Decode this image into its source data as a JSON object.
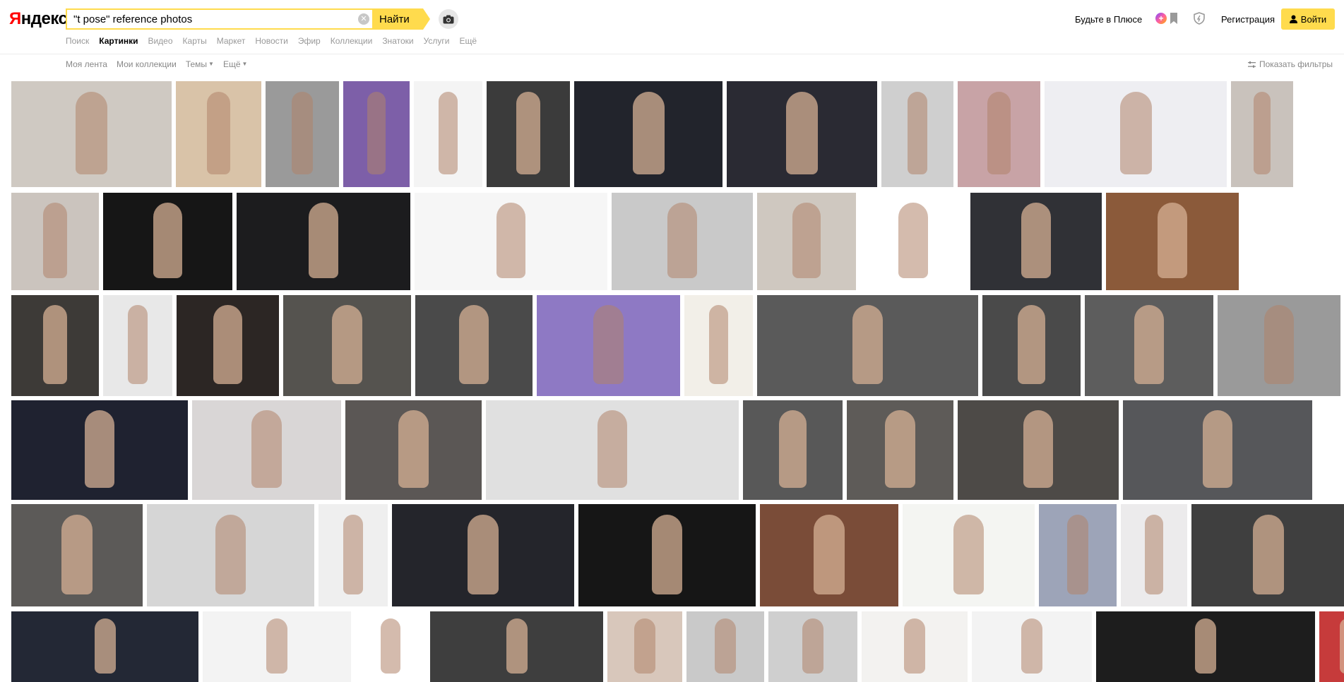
{
  "header": {
    "logo_ya": "Я",
    "logo_rest": "ндекс",
    "search_value": "\"t pose\" reference photos",
    "find_label": "Найти",
    "plus_label": "Будьте в Плюсе",
    "register_label": "Регистрация",
    "login_label": "Войти"
  },
  "nav": [
    "Поиск",
    "Картинки",
    "Видео",
    "Карты",
    "Маркет",
    "Новости",
    "Эфир",
    "Коллекции",
    "Знатоки",
    "Услуги",
    "Ещё"
  ],
  "nav_active": 1,
  "subnav": {
    "feed": "Моя лента",
    "collections": "Мои коллекции",
    "themes": "Темы",
    "more": "Ещё",
    "filters": "Показать фильтры"
  },
  "colors": {
    "accent": "#ffdb4d",
    "logo_red": "#ff0000",
    "muted_text": "#999999"
  },
  "image_results": {
    "rows": [
      [
        "#cfc9c2",
        "#d9c3a8",
        "#9a9a9a",
        "#7d5fa8",
        "#f4f4f4",
        "#3b3b3b",
        "#22242c",
        "#2a2a33",
        "#cfcfcf",
        "#c8a3a6",
        "#eeeef2",
        "#c9c2bc"
      ],
      [
        "#cbc4be",
        "#161616",
        "#1c1c1e",
        "#f6f6f6",
        "#c9c9c9",
        "#cfc8c0",
        "#ffffff",
        "#303136",
        "#8b5a3a"
      ],
      [
        "#3d3a37",
        "#e8e8e8",
        "#2c2624",
        "#55534f",
        "#4a4a4a",
        "#8e79c4",
        "#f2efe8",
        "#5a5a5a",
        "#4a4a4a",
        "#5d5d5d",
        "#9a9a9a"
      ],
      [
        "#1f2230",
        "#d9d6d6",
        "#5b5755",
        "#e0e0e0",
        "#585858",
        "#5e5b58",
        "#4d4a47",
        "#56575a"
      ],
      [
        "#5c5a58",
        "#d6d6d6",
        "#efefef",
        "#24252b",
        "#161616",
        "#7a4c38",
        "#f4f5f2",
        "#9da4b8",
        "#ecebec",
        "#3f3f3f"
      ],
      [
        "#232835",
        "#f3f3f3",
        "#ffffff",
        "#3e3e3e",
        "#d8c7bb",
        "#c9c9c9",
        "#cfcfcf",
        "#f3f2f0",
        "#f3f3f3",
        "#1d1d1d",
        "#c63b3b"
      ]
    ]
  }
}
